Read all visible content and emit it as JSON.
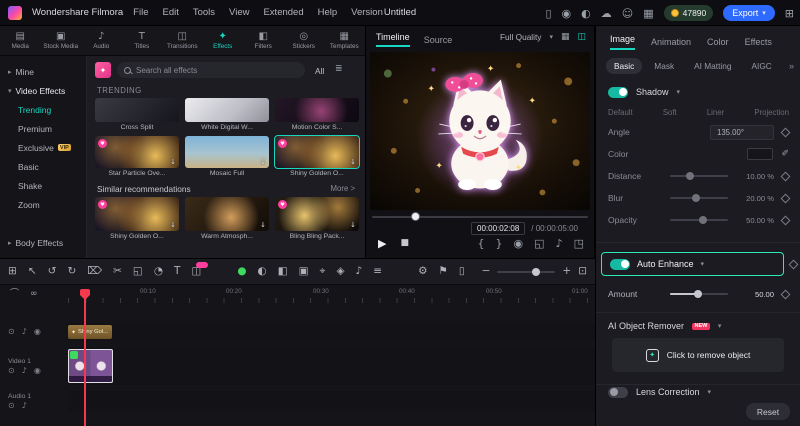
{
  "colors": {
    "accent": "#17d7c0",
    "highlight": "#2fe9b2",
    "export_blue": "#2f6aff",
    "pink": "#ff3e9d",
    "gold": "#ffc43d"
  },
  "titlebar": {
    "app_name": "Wondershare Filmora",
    "menus": [
      "File",
      "Edit",
      "Tools",
      "View",
      "Extended",
      "Help",
      "Version"
    ],
    "project_title": "Untitled",
    "coins": "47890",
    "export_label": "Export"
  },
  "media_tabs": {
    "items": [
      "Media",
      "Stock Media",
      "Audio",
      "Titles",
      "Transitions",
      "Effects",
      "Filters",
      "Stickers",
      "Templates"
    ]
  },
  "sidebar": {
    "mine": "Mine",
    "video_effects": "Video Effects",
    "items": [
      "Trending",
      "Premium",
      "Exclusive",
      "Basic",
      "Shake",
      "Zoom"
    ],
    "vip_badge": "VIP",
    "body_effects": "Body Effects"
  },
  "effects": {
    "search_placeholder": "Search all effects",
    "filter_all": "All",
    "trending_title": "TRENDING",
    "row1": [
      "Cross Split",
      "White Digital W...",
      "Motion Color S..."
    ],
    "row2": [
      "Star Particle Ove...",
      "Mosaic Full",
      "Shiny Golden O..."
    ],
    "similar_title": "Similar recommendations",
    "more_label": "More >",
    "similar": [
      "Shiny Golden O...",
      "Warm Atmosph...",
      "Bling Bling Pack..."
    ]
  },
  "preview": {
    "tabs": [
      "Timeline",
      "Source"
    ],
    "quality": "Full Quality",
    "current_time": "00:00:02:08",
    "total_time": "/ 00:00:05:00"
  },
  "props": {
    "tabs": [
      "Image",
      "Animation",
      "Color",
      "Effects"
    ],
    "subtabs": [
      "Basic",
      "Mask",
      "AI Matting",
      "AIGC"
    ],
    "overflow": "»",
    "shadow": {
      "label": "Shadow",
      "presets": [
        "Default",
        "Soft",
        "Liner",
        "Projection"
      ],
      "angle_label": "Angle",
      "angle_value": "135.00°",
      "color_label": "Color",
      "distance_label": "Distance",
      "distance_value": "10.00 %",
      "blur_label": "Blur",
      "blur_value": "20.00 %",
      "opacity_label": "Opacity",
      "opacity_value": "50.00 %"
    },
    "auto_enhance": {
      "label": "Auto Enhance",
      "amount_label": "Amount",
      "amount_value": "50.00"
    },
    "ai_remover": {
      "label": "AI Object Remover",
      "badge": "NEW",
      "button_label": "Click to remove object"
    },
    "lens_label": "Lens Correction",
    "reset_label": "Reset"
  },
  "timeline": {
    "ruler": [
      "00:10",
      "00:20",
      "00:30",
      "00:40",
      "00:50",
      "01:00"
    ],
    "video_track": "Video 1",
    "audio_track": "Audio 1",
    "fx_clip": "Shiny Gol..."
  }
}
